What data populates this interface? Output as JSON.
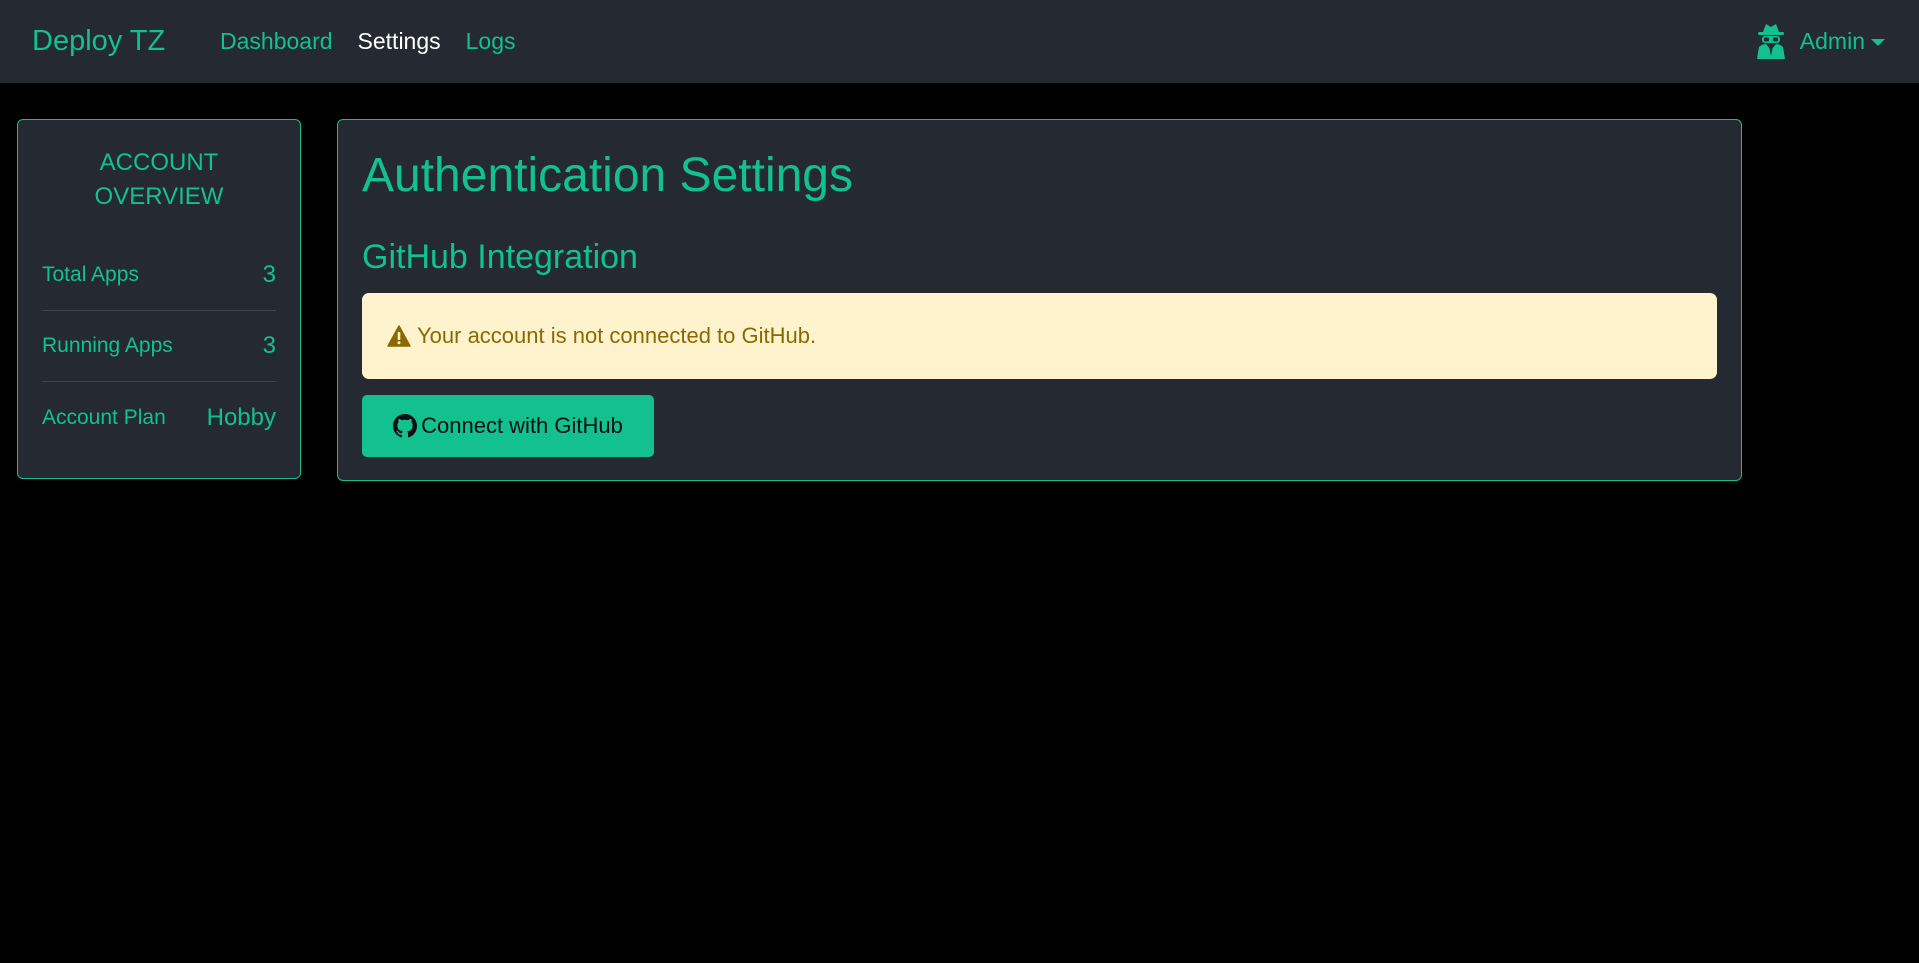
{
  "navbar": {
    "brand": "Deploy TZ",
    "links": [
      {
        "label": "Dashboard",
        "active": false
      },
      {
        "label": "Settings",
        "active": true
      },
      {
        "label": "Logs",
        "active": false
      }
    ],
    "user": {
      "name": "Admin",
      "icon": "user-secret-icon"
    }
  },
  "sidebar": {
    "title": "ACCOUNT OVERVIEW",
    "stats": [
      {
        "label": "Total Apps",
        "value": "3"
      },
      {
        "label": "Running Apps",
        "value": "3"
      },
      {
        "label": "Account Plan",
        "value": "Hobby"
      }
    ]
  },
  "main": {
    "title": "Authentication Settings",
    "section_title": "GitHub Integration",
    "alert": {
      "icon": "warning-icon",
      "text": "Your account is not connected to GitHub."
    },
    "connect_button": {
      "icon": "github-icon",
      "label": "Connect with GitHub"
    }
  },
  "colors": {
    "accent": "#13c08f",
    "navbar_bg": "#242932",
    "card_bg": "#242932",
    "page_bg": "#000000",
    "alert_bg": "#fff3cd",
    "alert_text": "#8a6a00"
  }
}
